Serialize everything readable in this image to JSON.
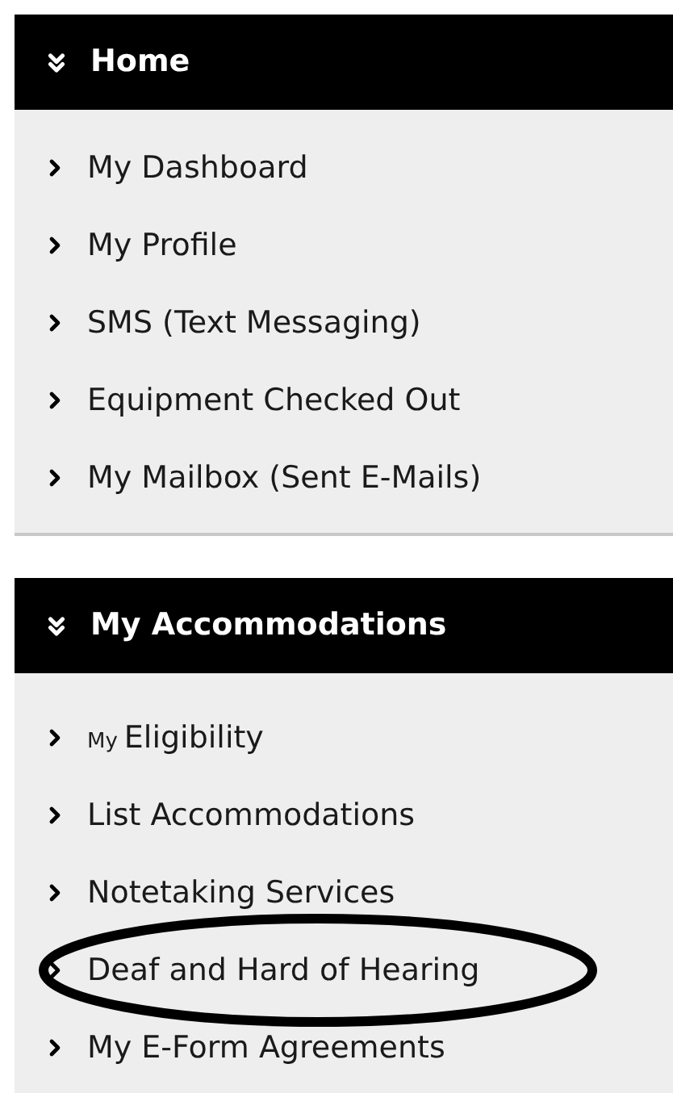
{
  "sections": [
    {
      "title": "Home",
      "items": [
        {
          "label": "My Dashboard",
          "circled": false
        },
        {
          "label": "My Profile",
          "circled": false
        },
        {
          "label": "SMS (Text Messaging)",
          "circled": false
        },
        {
          "label": "Equipment Checked Out",
          "circled": false
        },
        {
          "label": "My Mailbox (Sent E-Mails)",
          "circled": false
        }
      ]
    },
    {
      "title": "My Accommodations",
      "items": [
        {
          "small_prefix": "My",
          "label": "Eligibility",
          "circled": false
        },
        {
          "label": "List Accommodations",
          "circled": false
        },
        {
          "label": "Notetaking Services",
          "circled": false
        },
        {
          "label": "Deaf and Hard of Hearing",
          "circled": true
        },
        {
          "label": "My E-Form Agreements",
          "circled": false
        }
      ]
    }
  ]
}
